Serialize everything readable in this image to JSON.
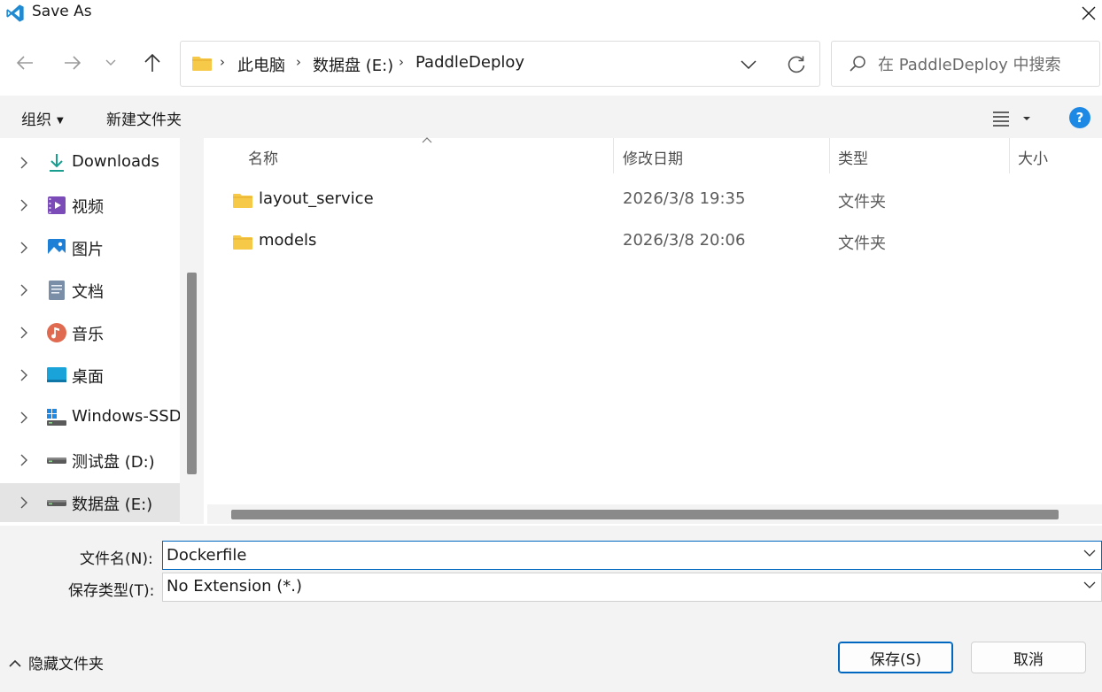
{
  "window": {
    "title": "Save As"
  },
  "address": {
    "crumbs": [
      "此电脑",
      "数据盘 (E:)",
      "PaddleDeploy"
    ]
  },
  "search": {
    "placeholder": "在 PaddleDeploy 中搜索"
  },
  "toolbar": {
    "organize": "组织",
    "new_folder": "新建文件夹",
    "help": "?"
  },
  "sidebar": {
    "items": [
      {
        "label": "Downloads",
        "icon": "download-icon"
      },
      {
        "label": "视频",
        "icon": "video-icon"
      },
      {
        "label": "图片",
        "icon": "pictures-icon"
      },
      {
        "label": "文档",
        "icon": "document-icon"
      },
      {
        "label": "音乐",
        "icon": "music-icon"
      },
      {
        "label": "桌面",
        "icon": "desktop-icon"
      },
      {
        "label": "Windows-SSD",
        "icon": "windows-drive-icon"
      },
      {
        "label": "测试盘 (D:)",
        "icon": "drive-icon"
      },
      {
        "label": "数据盘 (E:)",
        "icon": "drive-icon",
        "selected": true
      }
    ]
  },
  "filelist": {
    "columns": {
      "name": "名称",
      "modified": "修改日期",
      "type": "类型",
      "size": "大小"
    },
    "rows": [
      {
        "name": "layout_service",
        "modified": "2026/3/8 19:35",
        "type": "文件夹"
      },
      {
        "name": "models",
        "modified": "2026/3/8 20:06",
        "type": "文件夹"
      }
    ]
  },
  "form": {
    "filename_label": "文件名(N):",
    "filename_value": "Dockerfile",
    "filetype_label": "保存类型(T):",
    "filetype_value": "No Extension (*.)"
  },
  "footer": {
    "hide_folders": "隐藏文件夹",
    "save": "保存(S)",
    "cancel": "取消"
  },
  "colors": {
    "accent": "#0067c0",
    "folder": "#f7c948",
    "help": "#1e88e5"
  }
}
